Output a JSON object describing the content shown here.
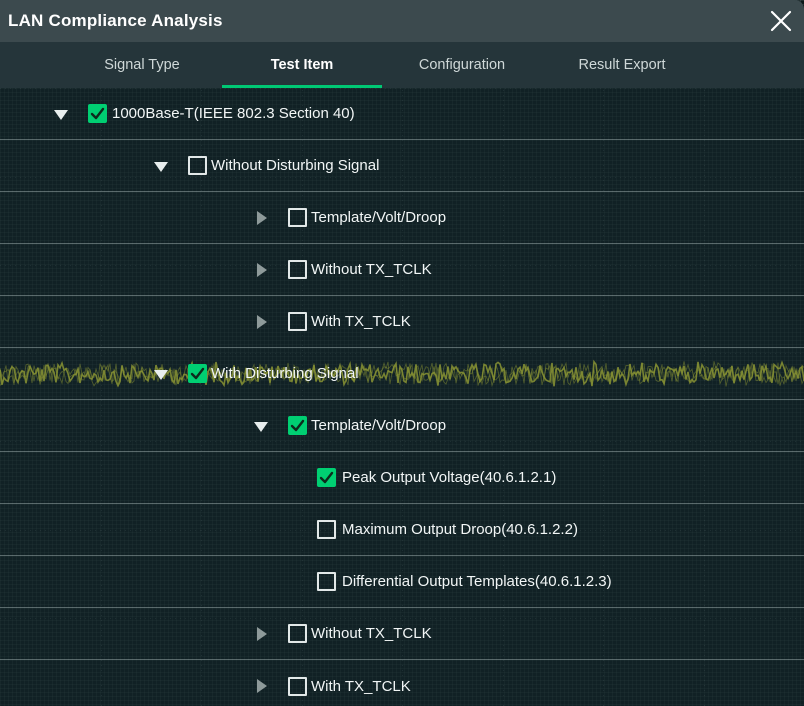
{
  "window": {
    "title": "LAN Compliance Analysis",
    "close_icon": "close-icon"
  },
  "tabs": [
    {
      "label": "Signal Type",
      "active": false
    },
    {
      "label": "Test Item",
      "active": true
    },
    {
      "label": "Configuration",
      "active": false
    },
    {
      "label": "Result Export",
      "active": false
    }
  ],
  "colors": {
    "accent_green": "#00c874",
    "checkbox_green": "#00cf72",
    "titlebar_bg": "#3c4a4e",
    "tabbar_bg": "#25353a",
    "panel_bg": "#132629",
    "row_divider": "#becdcd",
    "text": "#f2f6f6",
    "waveform": "#8a9434"
  },
  "tree": [
    {
      "label": "1000Base-T(IEEE 802.3 Section 40)",
      "level": 0,
      "checked": true,
      "arrow": "expanded",
      "arrow_icon": "triangle-down-icon",
      "checkbox_icon": "checkbox-checked-icon",
      "waveform": false
    },
    {
      "label": "Without Disturbing Signal",
      "level": 1,
      "checked": false,
      "arrow": "expanded",
      "arrow_icon": "triangle-down-icon",
      "checkbox_icon": "checkbox-unchecked-icon",
      "waveform": false
    },
    {
      "label": "Template/Volt/Droop",
      "level": 2,
      "checked": false,
      "arrow": "collapsed",
      "arrow_icon": "triangle-right-icon",
      "checkbox_icon": "checkbox-unchecked-icon",
      "waveform": false
    },
    {
      "label": "Without TX_TCLK",
      "level": 2,
      "checked": false,
      "arrow": "collapsed",
      "arrow_icon": "triangle-right-icon",
      "checkbox_icon": "checkbox-unchecked-icon",
      "waveform": false
    },
    {
      "label": "With TX_TCLK",
      "level": 2,
      "checked": false,
      "arrow": "collapsed",
      "arrow_icon": "triangle-right-icon",
      "checkbox_icon": "checkbox-unchecked-icon",
      "waveform": false
    },
    {
      "label": "With Disturbing Signal",
      "level": 1,
      "checked": true,
      "arrow": "expanded",
      "arrow_icon": "triangle-down-icon",
      "checkbox_icon": "checkbox-checked-icon",
      "waveform": true
    },
    {
      "label": "Template/Volt/Droop",
      "level": 2,
      "checked": true,
      "arrow": "expanded",
      "arrow_icon": "triangle-down-icon",
      "checkbox_icon": "checkbox-checked-icon",
      "waveform": false
    },
    {
      "label": "Peak Output Voltage(40.6.1.2.1)",
      "level": 3,
      "checked": true,
      "arrow": "none",
      "arrow_icon": "",
      "checkbox_icon": "checkbox-checked-icon",
      "waveform": false
    },
    {
      "label": "Maximum Output Droop(40.6.1.2.2)",
      "level": 3,
      "checked": false,
      "arrow": "none",
      "arrow_icon": "",
      "checkbox_icon": "checkbox-unchecked-icon",
      "waveform": false
    },
    {
      "label": "Differential Output Templates(40.6.1.2.3)",
      "level": 3,
      "checked": false,
      "arrow": "none",
      "arrow_icon": "",
      "checkbox_icon": "checkbox-unchecked-icon",
      "waveform": false
    },
    {
      "label": "Without TX_TCLK",
      "level": 2,
      "checked": false,
      "arrow": "collapsed",
      "arrow_icon": "triangle-right-icon",
      "checkbox_icon": "checkbox-unchecked-icon",
      "waveform": false
    },
    {
      "label": "With TX_TCLK",
      "level": 2,
      "checked": false,
      "arrow": "collapsed",
      "arrow_icon": "triangle-right-icon",
      "checkbox_icon": "checkbox-unchecked-icon",
      "waveform": false
    }
  ]
}
